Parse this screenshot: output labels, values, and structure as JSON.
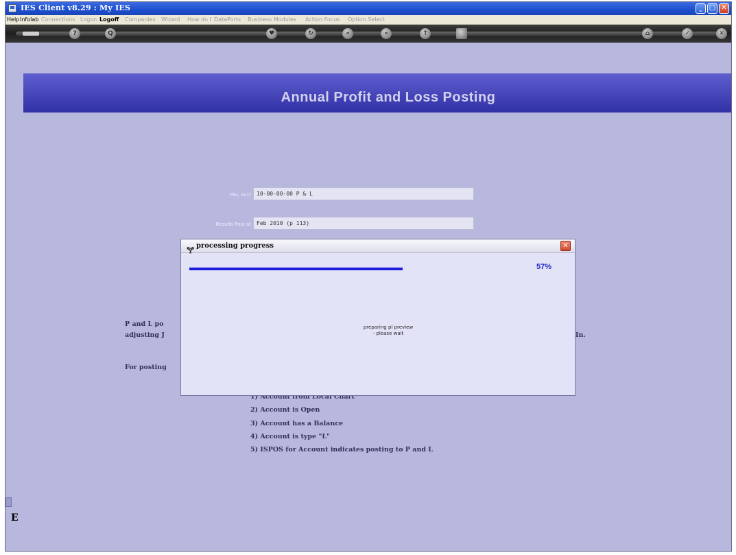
{
  "window": {
    "title": "IES Client v8.29 : My IES",
    "controls": {
      "minimize": "_",
      "maximize": "□",
      "close": "✕"
    }
  },
  "menubar": {
    "items": [
      {
        "label": "Help",
        "enabled": true
      },
      {
        "label": "Infolab",
        "enabled": true
      },
      {
        "label": "Connections",
        "enabled": false
      },
      {
        "label": "Logon",
        "enabled": false
      },
      {
        "label": "Logoff",
        "enabled": true,
        "bold": true
      },
      {
        "label": "Companies",
        "enabled": false
      },
      {
        "label": "Wizard",
        "enabled": false
      },
      {
        "label": "How do I",
        "enabled": false
      },
      {
        "label": "DataPorts",
        "enabled": false
      },
      {
        "label": "Business Modules",
        "enabled": false
      },
      {
        "label": "Action Focus",
        "enabled": false
      },
      {
        "label": "Option Select",
        "enabled": false
      }
    ]
  },
  "toolbar": {
    "icons": [
      "key-icon",
      "help-icon",
      "search-icon",
      "heart-icon",
      "refresh-icon",
      "rewind-icon",
      "fast-forward-icon",
      "upload-icon",
      "stop-icon",
      "home-icon",
      "check-icon",
      "close-icon"
    ]
  },
  "page": {
    "title": "Annual Profit and Loss Posting"
  },
  "form": {
    "pl_acct_label": "P&L Acct",
    "pl_acct_value": "10-00-00-00 P & L",
    "results_post_label": "Results Post at",
    "results_post_value": "Feb 2010 (p 113)"
  },
  "info": {
    "line1_left": "P and L po",
    "line2_left": "adjusting J",
    "line2_right": "In.",
    "line3_left": "For posting",
    "list_item_1": "1) Account from Local Chart",
    "list_item_2": "2) Account is Open",
    "list_item_3": "3) Account has a Balance",
    "list_item_4": "4) Account is type \"L\"",
    "list_item_5": "5) ISPOS for Account indicates posting to P and L"
  },
  "side": {
    "mark": "E"
  },
  "dialog": {
    "title": "processing progress",
    "icon": "wrench-icon",
    "close": "✕",
    "progress": 0.57,
    "percent_label": "57%",
    "message_line1": "preparing pl preview",
    "message_line2": "- please wait"
  },
  "colors": {
    "background": "#b8b8de",
    "banner": "#3f3fb2",
    "progress": "#1d1de0"
  }
}
